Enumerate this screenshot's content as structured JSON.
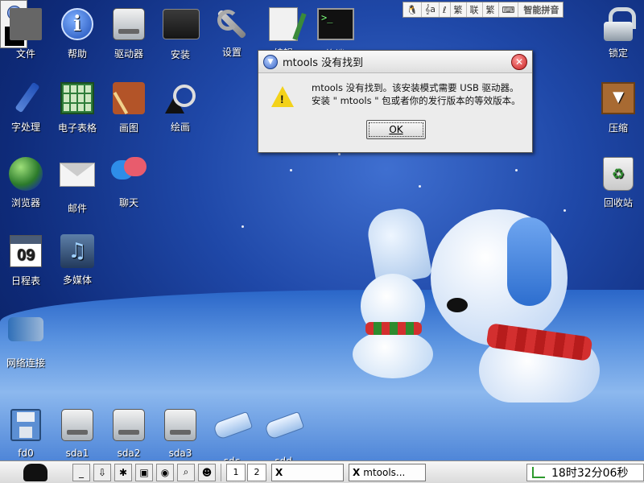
{
  "desktop": {
    "icons": [
      {
        "label": "文件",
        "icon": "folder-icon"
      },
      {
        "label": "帮助",
        "icon": "info-icon"
      },
      {
        "label": "驱动器",
        "icon": "drive-icon"
      },
      {
        "label": "安装",
        "icon": "installer-icon"
      },
      {
        "label": "设置",
        "icon": "wrench-icon"
      },
      {
        "label": "编辑",
        "icon": "edit-icon"
      },
      {
        "label": "终端",
        "icon": "terminal-icon"
      },
      {
        "label": "锁定",
        "icon": "lock-icon"
      },
      {
        "label": "字处理",
        "icon": "pen-icon"
      },
      {
        "label": "电子表格",
        "icon": "spreadsheet-icon"
      },
      {
        "label": "画图",
        "icon": "paint-icon"
      },
      {
        "label": "绘画",
        "icon": "shapes-icon"
      },
      {
        "label": "压缩",
        "icon": "archive-icon"
      },
      {
        "label": "浏览器",
        "icon": "globe-icon"
      },
      {
        "label": "邮件",
        "icon": "mail-icon"
      },
      {
        "label": "聊天",
        "icon": "chat-icon"
      },
      {
        "label": "回收站",
        "icon": "trash-icon"
      },
      {
        "label": "日程表",
        "icon": "calendar-icon",
        "day": "09"
      },
      {
        "label": "多媒体",
        "icon": "media-icon"
      },
      {
        "label": "网络连接",
        "icon": "network-plug-icon"
      },
      {
        "label": "fd0",
        "icon": "floppy-icon"
      },
      {
        "label": "sda1",
        "icon": "drive-icon"
      },
      {
        "label": "sda2",
        "icon": "drive-icon"
      },
      {
        "label": "sda3",
        "icon": "drive-icon"
      },
      {
        "label": "sdc",
        "icon": "usb-drive-icon"
      },
      {
        "label": "sdd",
        "icon": "usb-drive-icon"
      }
    ]
  },
  "ime_bar": {
    "segments": [
      "🐧",
      "𝄞a",
      "ℓ",
      "繁",
      "联",
      "繁",
      "⌨"
    ],
    "name": "智能拼音"
  },
  "dialog": {
    "title": "mtools 没有找到",
    "message_line1": "mtools 没有找到。该安装模式需要 USB 驱动器。",
    "message_line2": "安装 \" mtools \" 包或者你的发行版本的等效版本。",
    "ok_label": "OK"
  },
  "taskbar": {
    "workspaces": [
      "1",
      "2"
    ],
    "tasks": [
      {
        "label": ""
      },
      {
        "label": "mtools..."
      }
    ],
    "clock": "18时32分06秒"
  }
}
